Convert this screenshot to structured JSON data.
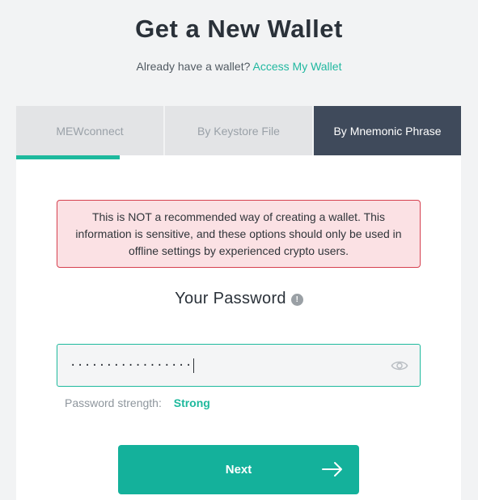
{
  "header": {
    "title": "Get a New Wallet",
    "subtitle_text": "Already have a wallet?",
    "subtitle_link": "Access My Wallet"
  },
  "tabs": [
    {
      "label": "MEWconnect",
      "active": false
    },
    {
      "label": "By Keystore File",
      "active": false
    },
    {
      "label": "By Mnemonic Phrase",
      "active": true
    }
  ],
  "warning": {
    "text": "This is NOT a recommended way of creating a wallet. This information is sensitive, and these options should only be used in offline settings by experienced crypto users."
  },
  "password": {
    "heading": "Your Password",
    "info_icon": "!",
    "masked_value": "·················",
    "strength_label": "Password strength:",
    "strength_value": "Strong"
  },
  "actions": {
    "next_label": "Next"
  },
  "icons": {
    "info": "info-icon",
    "eye": "eye-icon",
    "arrow": "arrow-right-icon"
  },
  "colors": {
    "accent": "#1eb99d",
    "active_tab": "#3f4a5b",
    "warning_bg": "#fbe1e4",
    "warning_border": "#d6404f"
  }
}
